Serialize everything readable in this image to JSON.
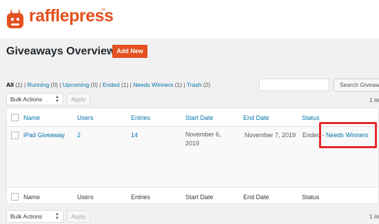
{
  "brand": {
    "name": "rafflepress",
    "tm": "™",
    "color": "#e4501f"
  },
  "page": {
    "title": "Giveaways Overview",
    "add_new_label": "Add New"
  },
  "filters": [
    {
      "label": "All",
      "count": "(1)",
      "current": true
    },
    {
      "label": "Running",
      "count": "(0)",
      "current": false
    },
    {
      "label": "Upcoming",
      "count": "(0)",
      "current": false
    },
    {
      "label": "Ended",
      "count": "(1)",
      "current": false
    },
    {
      "label": "Needs Winners",
      "count": "(1)",
      "current": false
    },
    {
      "label": "Trash",
      "count": "(2)",
      "current": false
    }
  ],
  "search": {
    "button_label": "Search Giveaw",
    "value": ""
  },
  "top_nav": {
    "bulk_label": "Bulk Actions",
    "apply_label": "Apply",
    "items_count": "1 ite"
  },
  "bottom_nav": {
    "bulk_label": "Bulk Actions",
    "apply_label": "Apply",
    "items_count": "1 ite"
  },
  "columns": [
    "Name",
    "Users",
    "Entries",
    "Start Date",
    "End Date",
    "Status"
  ],
  "rows": [
    {
      "name": "iPad Giveaway",
      "users": "2",
      "entries": "14",
      "start_line1": "November 6,",
      "start_line2": "2019",
      "end_date": "November 7, 2019",
      "status_prefix": "Ended -",
      "status_link": "Needs Winners"
    }
  ],
  "colors": {
    "link": "#0073aa",
    "highlight": "#e5262b",
    "accent": "#e4501f"
  }
}
